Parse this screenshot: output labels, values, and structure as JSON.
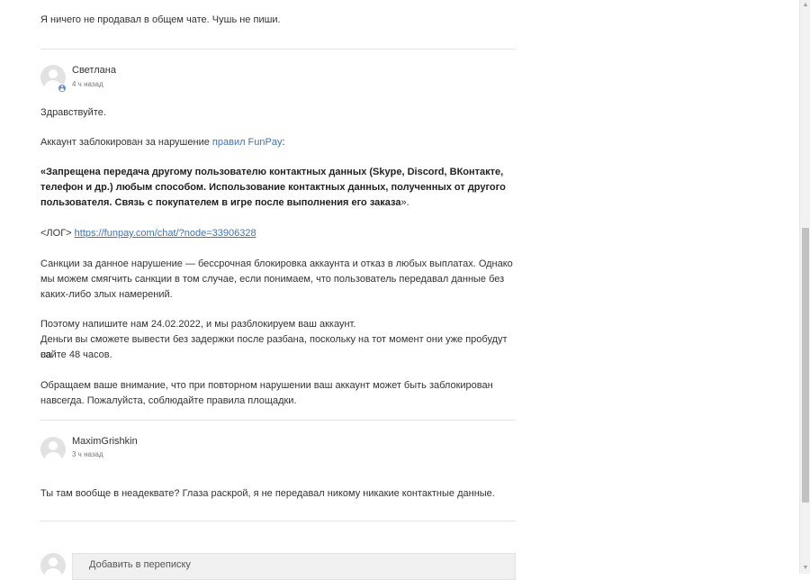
{
  "messages": [
    {
      "author": "",
      "time": "",
      "paragraphs": [
        "Я ничего не продавал в общем чате. Чушь не пиши."
      ]
    },
    {
      "author": "Светлана",
      "time": "4 ч назад",
      "greeting": "Здравствуйте.",
      "blocked_prefix": "Аккаунт заблокирован за нарушение ",
      "rules_link": "правил FunPay",
      "blocked_suffix": ":",
      "quote_open": "«",
      "quote_bold_1": "Запрещена передача другому пользователю контактных данных (Skype, Discord, ВКонтакте,",
      "quote_bold_2": "телефон и др.) любым способом. Использование контактных данных, полученных от другого",
      "quote_bold_3": "пользователя. Связь с покупателем в игре после выполнения его заказа",
      "quote_close": "».",
      "log_label": "<ЛОГ> ",
      "log_url": "https://funpay.com/chat/?node=33906328",
      "sanctions_1": "Санкции за данное нарушение — бессрочная блокировка аккаунта и отказ в любых выплатах. Однако",
      "sanctions_2": "мы можем смягчить санкции в том случае, если понимаем, что пользователь передавал данные без",
      "sanctions_3": "каких-либо злых намерений.",
      "write_1": "Поэтому напишите нам 24.02.2022, и мы разблокируем ваш аккаунт.",
      "write_2": "Деньги вы сможете вывести без задержки после разбана, поскольку на тот момент они уже пробудут на",
      "write_3": "сайте 48 часов.",
      "warning_1": "Обращаем ваше внимание, что при повторном нарушении ваш аккаунт может быть заблокирован",
      "warning_2": "навсегда. Пожалуйста, соблюдайте правила площадки."
    },
    {
      "author": "MaximGrishkin",
      "time": "3 ч назад",
      "text": "Ты там вообще в неадеквате? Глаза раскрой, я не передавал никому никакие контактные данные."
    }
  ],
  "reply": {
    "placeholder": "Добавить в переписку"
  },
  "icons": {
    "avatar": "user-avatar-placeholder-icon",
    "badge": "support-agent-badge-icon",
    "scroll_up": "arrow-up-icon",
    "scroll_down": "arrow-down-icon"
  },
  "colors": {
    "link": "#3e73b9",
    "badge": "#6a8fc9",
    "divider": "#e3e3e3"
  }
}
